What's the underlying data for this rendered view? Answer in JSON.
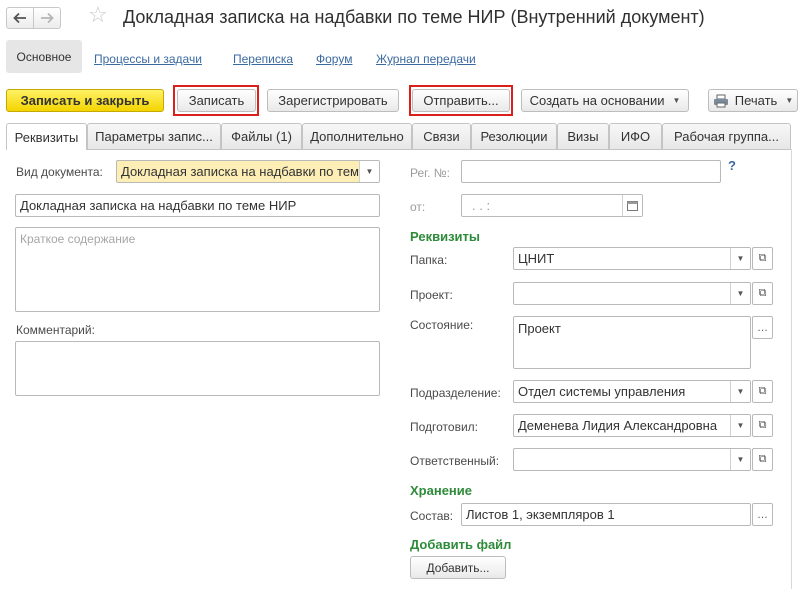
{
  "window": {
    "title": "Докладная записка на надбавки по теме НИР (Внутренний документ)"
  },
  "sections": {
    "main": "Основное",
    "processes": "Процессы и задачи",
    "correspondence": "Переписка",
    "forum": "Форум",
    "transfer_log": "Журнал передачи"
  },
  "toolbar": {
    "save_close": "Записать и закрыть",
    "save": "Записать",
    "register": "Зарегистрировать",
    "send": "Отправить...",
    "create_based": "Создать на основании",
    "print": "Печать"
  },
  "tabs": [
    "Реквизиты",
    "Параметры запис...",
    "Файлы (1)",
    "Дополнительно",
    "Связи",
    "Резолюции",
    "Визы",
    "ИФО",
    "Рабочая группа..."
  ],
  "form": {
    "doc_type_label": "Вид документа:",
    "doc_type_value": "Докладная записка на надбавки по теме НИР",
    "title_value": "Докладная записка на надбавки по теме НИР",
    "summary_placeholder": "Краткое содержание",
    "comment_label": "Комментарий:",
    "reg_no_label": "Рег. №:",
    "help_mark": "?",
    "from_label": "от:",
    "date_mask": ". .    :",
    "requisites_header": "Реквизиты",
    "folder_label": "Папка:",
    "folder_value": "ЦНИТ",
    "project_label": "Проект:",
    "project_value": "",
    "state_label": "Состояние:",
    "state_value": "Проект",
    "department_label": "Подразделение:",
    "department_value": "Отдел системы управления",
    "prepared_label": "Подготовил:",
    "prepared_value": "Деменева Лидия Александровна",
    "responsible_label": "Ответственный:",
    "responsible_value": "",
    "storage_header": "Хранение",
    "composition_label": "Состав:",
    "composition_value": "Листов 1, экземпляров 1",
    "add_file_header": "Добавить файл",
    "add_button": "Добавить..."
  },
  "colors": {
    "primary_button": "#f4d400",
    "highlight_box": "#d9201b",
    "section_header": "#2e8b3a",
    "link": "#3b6aa0",
    "doc_type_field": "#fdeeb6"
  }
}
